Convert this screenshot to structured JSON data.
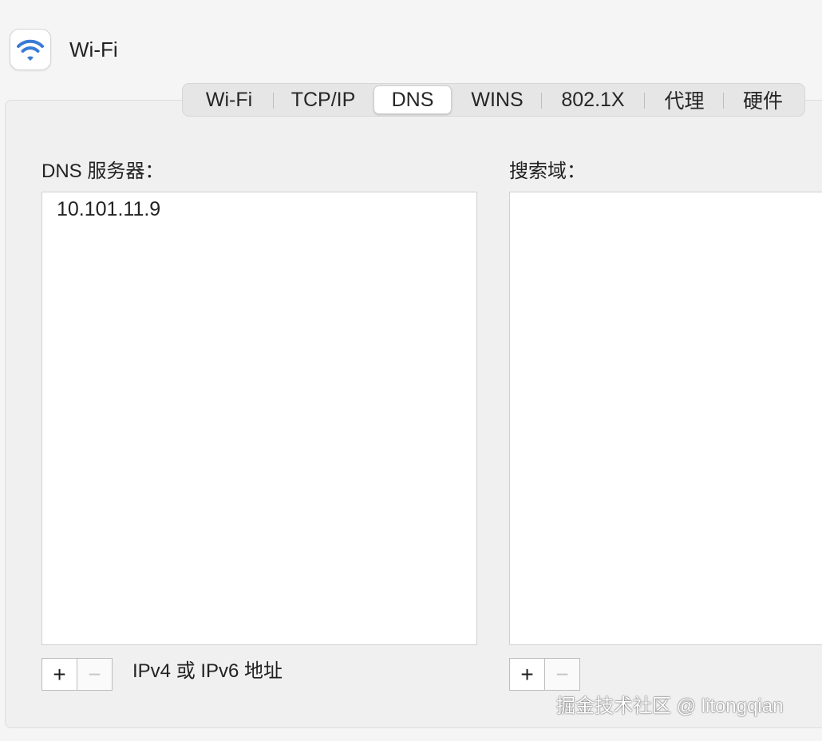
{
  "header": {
    "title": "Wi-Fi",
    "icon": "wifi-icon"
  },
  "tabs": [
    {
      "label": "Wi-Fi",
      "active": false
    },
    {
      "label": "TCP/IP",
      "active": false
    },
    {
      "label": "DNS",
      "active": true
    },
    {
      "label": "WINS",
      "active": false
    },
    {
      "label": "802.1X",
      "active": false
    },
    {
      "label": "代理",
      "active": false
    },
    {
      "label": "硬件",
      "active": false
    }
  ],
  "dns": {
    "label": "DNS 服务器：",
    "entries": [
      "10.101.11.9"
    ],
    "add_label": "+",
    "remove_label": "−",
    "hint": "IPv4 或 IPv6 地址"
  },
  "search": {
    "label": "搜索域：",
    "entries": [],
    "add_label": "+",
    "remove_label": "−"
  },
  "watermark": "掘金技术社区 @ litongqian",
  "colors": {
    "accent": "#3a7bd5",
    "active_tab": "#ffffff",
    "panel": "#f0f0f0"
  }
}
